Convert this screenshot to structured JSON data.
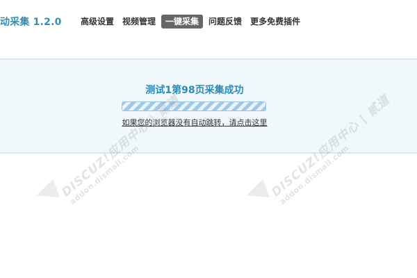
{
  "header": {
    "app_title": "动采集 1.2.0"
  },
  "nav": {
    "items": [
      {
        "label": "高级设置"
      },
      {
        "label": "视频管理"
      },
      {
        "label": "一键采集",
        "active": true
      },
      {
        "label": "问题反馈"
      },
      {
        "label": "更多免费插件"
      }
    ]
  },
  "message": {
    "title": "测试1第98页采集成功",
    "progress_percent": 100,
    "redirect_text": "如果您的浏览器没有自动跳转，请点击这里"
  },
  "watermark": {
    "brand": "DISCUZ!应用中心 | 贰道",
    "url": "addon.dismall.com"
  },
  "colors": {
    "accent": "#2a8cb5",
    "active_tab_bg": "#666666",
    "panel_bg": "#f1f8fc",
    "panel_border": "#d7e8f3"
  }
}
